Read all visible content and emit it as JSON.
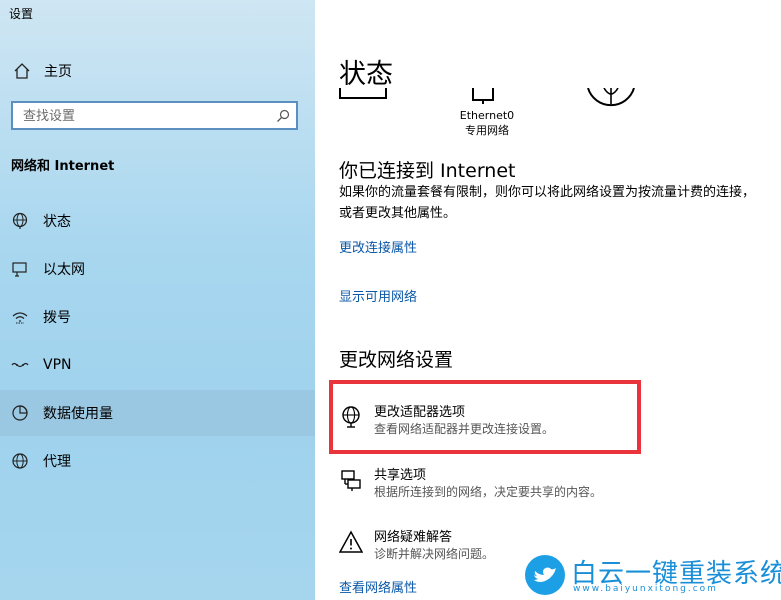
{
  "window": {
    "title": "设置"
  },
  "sidebar": {
    "home_label": "主页",
    "search_placeholder": "查找设置",
    "section_title": "网络和 Internet",
    "items": [
      {
        "label": "状态",
        "icon": "globe-status-icon"
      },
      {
        "label": "以太网",
        "icon": "ethernet-icon"
      },
      {
        "label": "拨号",
        "icon": "dialup-icon"
      },
      {
        "label": "VPN",
        "icon": "vpn-icon"
      },
      {
        "label": "数据使用量",
        "icon": "data-usage-icon",
        "selected": true
      },
      {
        "label": "代理",
        "icon": "proxy-globe-icon"
      }
    ]
  },
  "main": {
    "title": "状态",
    "network": {
      "adapter_name": "Ethernet0",
      "adapter_type": "专用网络"
    },
    "connected_heading": "你已连接到 Internet",
    "connected_desc": "如果你的流量套餐有限制，则你可以将此网络设置为按流量计费的连接，或者更改其他属性。",
    "links": {
      "change_props": "更改连接属性",
      "show_networks": "显示可用网络",
      "view_props": "查看网络属性"
    },
    "change_heading": "更改网络设置",
    "options": [
      {
        "title": "更改适配器选项",
        "desc": "查看网络适配器并更改连接设置。",
        "icon": "adapter-globe-icon"
      },
      {
        "title": "共享选项",
        "desc": "根据所连接到的网络，决定要共享的内容。",
        "icon": "sharing-icon"
      },
      {
        "title": "网络疑难解答",
        "desc": "诊断并解决网络问题。",
        "icon": "warning-icon"
      }
    ]
  },
  "watermark": {
    "brand": "白云一键重装系统",
    "url": "www.baiyunxitong.com"
  },
  "colors": {
    "link": "#0a58a8",
    "highlight": "#e8343a",
    "watermark": "#1a8fd8"
  }
}
